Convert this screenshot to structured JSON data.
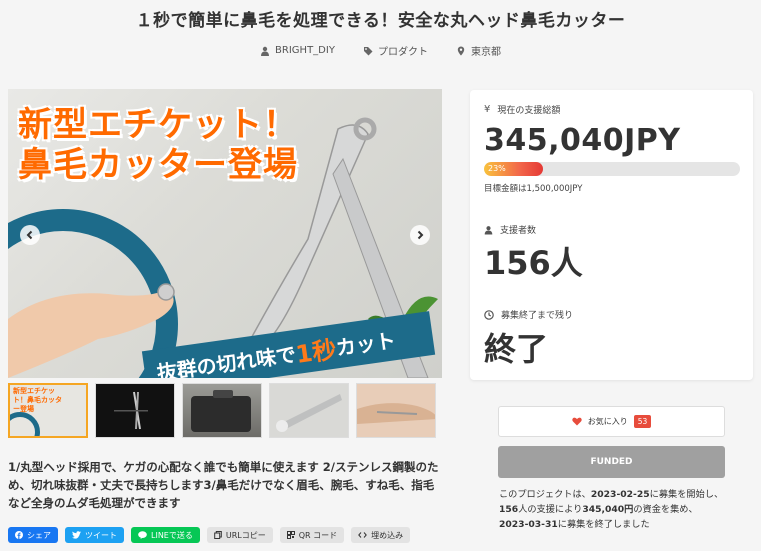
{
  "project": {
    "title": "１秒で簡単に鼻毛を処理できる！安全な丸ヘッド鼻毛カッター",
    "meta": [
      {
        "icon": "user-icon",
        "label": "BRIGHT_DIY"
      },
      {
        "icon": "tag-icon",
        "label": "プロダクト"
      },
      {
        "icon": "location-pin-icon",
        "label": "東京都"
      }
    ],
    "hero": {
      "headline_1": "新型エチケット！",
      "headline_2": "鼻毛カッター登場",
      "banner_pre": "抜群の切れ味で",
      "banner_accent": "1秒",
      "banner_post": "カット"
    },
    "thumb_caption": "新型エチケット！鼻毛カッター登場",
    "description": "1/丸型ヘッド採用で、ケガの心配なく誰でも簡単に使えます 2/ステンレス鋼製のため、切れ味抜群・丈夫で長持ちします3/鼻毛だけでなく眉毛、腕毛、すね毛、指毛など全身のムダ毛処理ができます"
  },
  "share": {
    "facebook": "シェア",
    "twitter": "ツイート",
    "line": "LINEで送る",
    "url_copy": "URLコピー",
    "qr": "QR コード",
    "embed": "埋め込み"
  },
  "stats": {
    "total_label": "現在の支援総額",
    "total_value": "345,040JPY",
    "progress_percent": 23,
    "progress_label": "23%",
    "goal_text": "目標金額は1,500,000JPY",
    "backers_label": "支援者数",
    "backers_value": "156人",
    "remaining_label": "募集終了まで残り",
    "remaining_value": "終了"
  },
  "actions": {
    "favorite_label": "お気に入り",
    "favorite_count": "53",
    "funded_label": "FUNDED"
  },
  "summary": {
    "p1": "このプロジェクトは、",
    "start": "2023-02-25",
    "p2": "に募集を開始し、",
    "backers": "156",
    "p3": "人の支援により",
    "amount": "345,040円",
    "p4": "の資金を集め、",
    "end": "2023-03-31",
    "p5": "に募集を終了しました"
  },
  "colors": {
    "accent_orange": "#ff6a00",
    "banner_blue": "#1d6b8a",
    "favorite_red": "#e74c3c",
    "funded_gray": "#a0a0a0"
  }
}
